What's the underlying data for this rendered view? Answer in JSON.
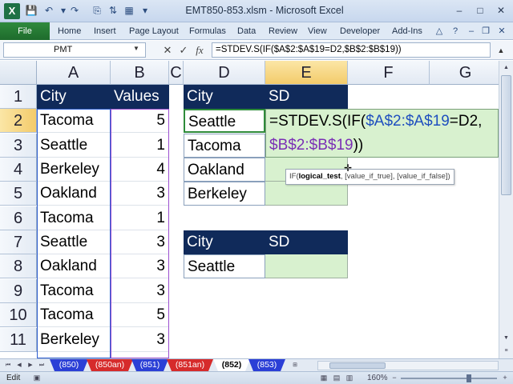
{
  "window": {
    "title": "EMT850-853.xlsm - Microsoft Excel",
    "app_icon": "X",
    "qa_icons": [
      "save-icon",
      "undo-icon",
      "redo-icon"
    ],
    "controls": [
      "–",
      "□",
      "✕"
    ]
  },
  "ribbon": {
    "file_tab": "File",
    "tabs": [
      "Home",
      "Insert",
      "Page Layout",
      "Formulas",
      "Data",
      "Review",
      "View",
      "Developer",
      "Add-Ins"
    ]
  },
  "formula_bar": {
    "name_box": "PMT",
    "cancel": "✕",
    "enter": "✓",
    "fx": "fx",
    "formula": "=STDEV.S(IF($A$2:$A$19=D2,$B$2:$B$19))"
  },
  "columns": [
    "A",
    "B",
    "C",
    "D",
    "E",
    "F",
    "G"
  ],
  "rows": [
    "1",
    "2",
    "3",
    "4",
    "5",
    "6",
    "7",
    "8",
    "9",
    "10",
    "11"
  ],
  "sheet": {
    "a_header": "City",
    "b_header": "Values",
    "data": [
      {
        "city": "Tacoma",
        "value": "5"
      },
      {
        "city": "Seattle",
        "value": "1"
      },
      {
        "city": "Berkeley",
        "value": "4"
      },
      {
        "city": "Oakland",
        "value": "3"
      },
      {
        "city": "Tacoma",
        "value": "1"
      },
      {
        "city": "Seattle",
        "value": "3"
      },
      {
        "city": "Oakland",
        "value": "3"
      },
      {
        "city": "Tacoma",
        "value": "3"
      },
      {
        "city": "Tacoma",
        "value": "5"
      },
      {
        "city": "Berkeley",
        "value": "3"
      }
    ],
    "table1": {
      "city_header": "City",
      "sd_header": "SD",
      "cities": [
        "Seattle",
        "Tacoma",
        "Oakland",
        "Berkeley"
      ]
    },
    "table2": {
      "city_header": "City",
      "sd_header": "SD",
      "city": "Seattle"
    },
    "formula_parts": {
      "p1": "=STDEV.S(IF(",
      "p2": "$A$2:$A$19",
      "p3": "=D2,",
      "p4": "$B$2:$B$19",
      "p5": "))"
    }
  },
  "tooltip": {
    "fn": "IF(",
    "arg1": "logical_test",
    "rest": ", [value_if_true], [value_if_false])"
  },
  "sheet_tabs": [
    "(850)",
    "(850an)",
    "(851)",
    "(851an)",
    "(852)",
    "(853)"
  ],
  "status": {
    "mode": "Edit",
    "zoom": "160%"
  }
}
